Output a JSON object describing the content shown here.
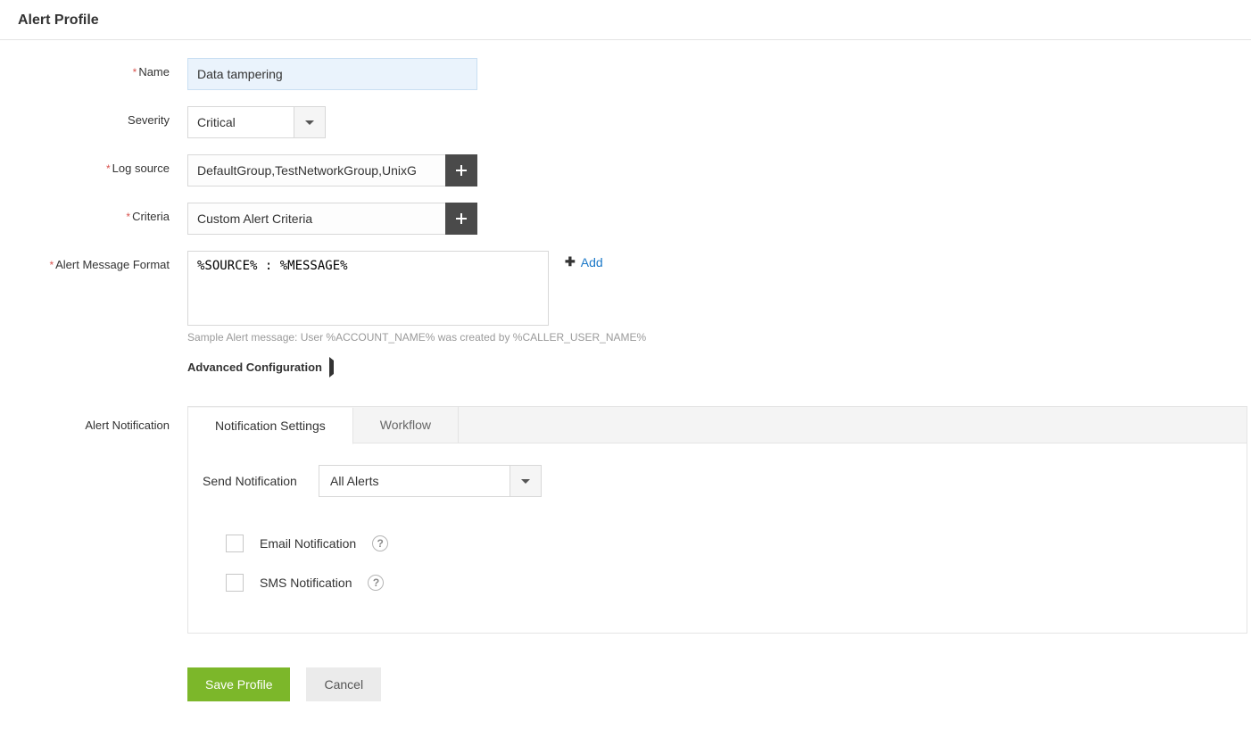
{
  "pageTitle": "Alert Profile",
  "labels": {
    "name": "Name",
    "severity": "Severity",
    "logSource": "Log source",
    "criteria": "Criteria",
    "messageFormat": "Alert Message Format",
    "alertNotification": "Alert Notification",
    "sendNotification": "Send Notification",
    "emailNotification": "Email Notification",
    "smsNotification": "SMS Notification",
    "advanced": "Advanced Configuration"
  },
  "values": {
    "name": "Data tampering",
    "severity": "Critical",
    "logSource": "DefaultGroup,TestNetworkGroup,UnixG",
    "criteria": "Custom Alert Criteria",
    "messageFormat": "%SOURCE% : %MESSAGE%",
    "sendNotification": "All Alerts"
  },
  "helper": {
    "sample": "Sample Alert message: User %ACCOUNT_NAME% was created by %CALLER_USER_NAME%"
  },
  "tabs": {
    "settings": "Notification Settings",
    "workflow": "Workflow"
  },
  "actions": {
    "add": "Add",
    "save": "Save Profile",
    "cancel": "Cancel"
  }
}
